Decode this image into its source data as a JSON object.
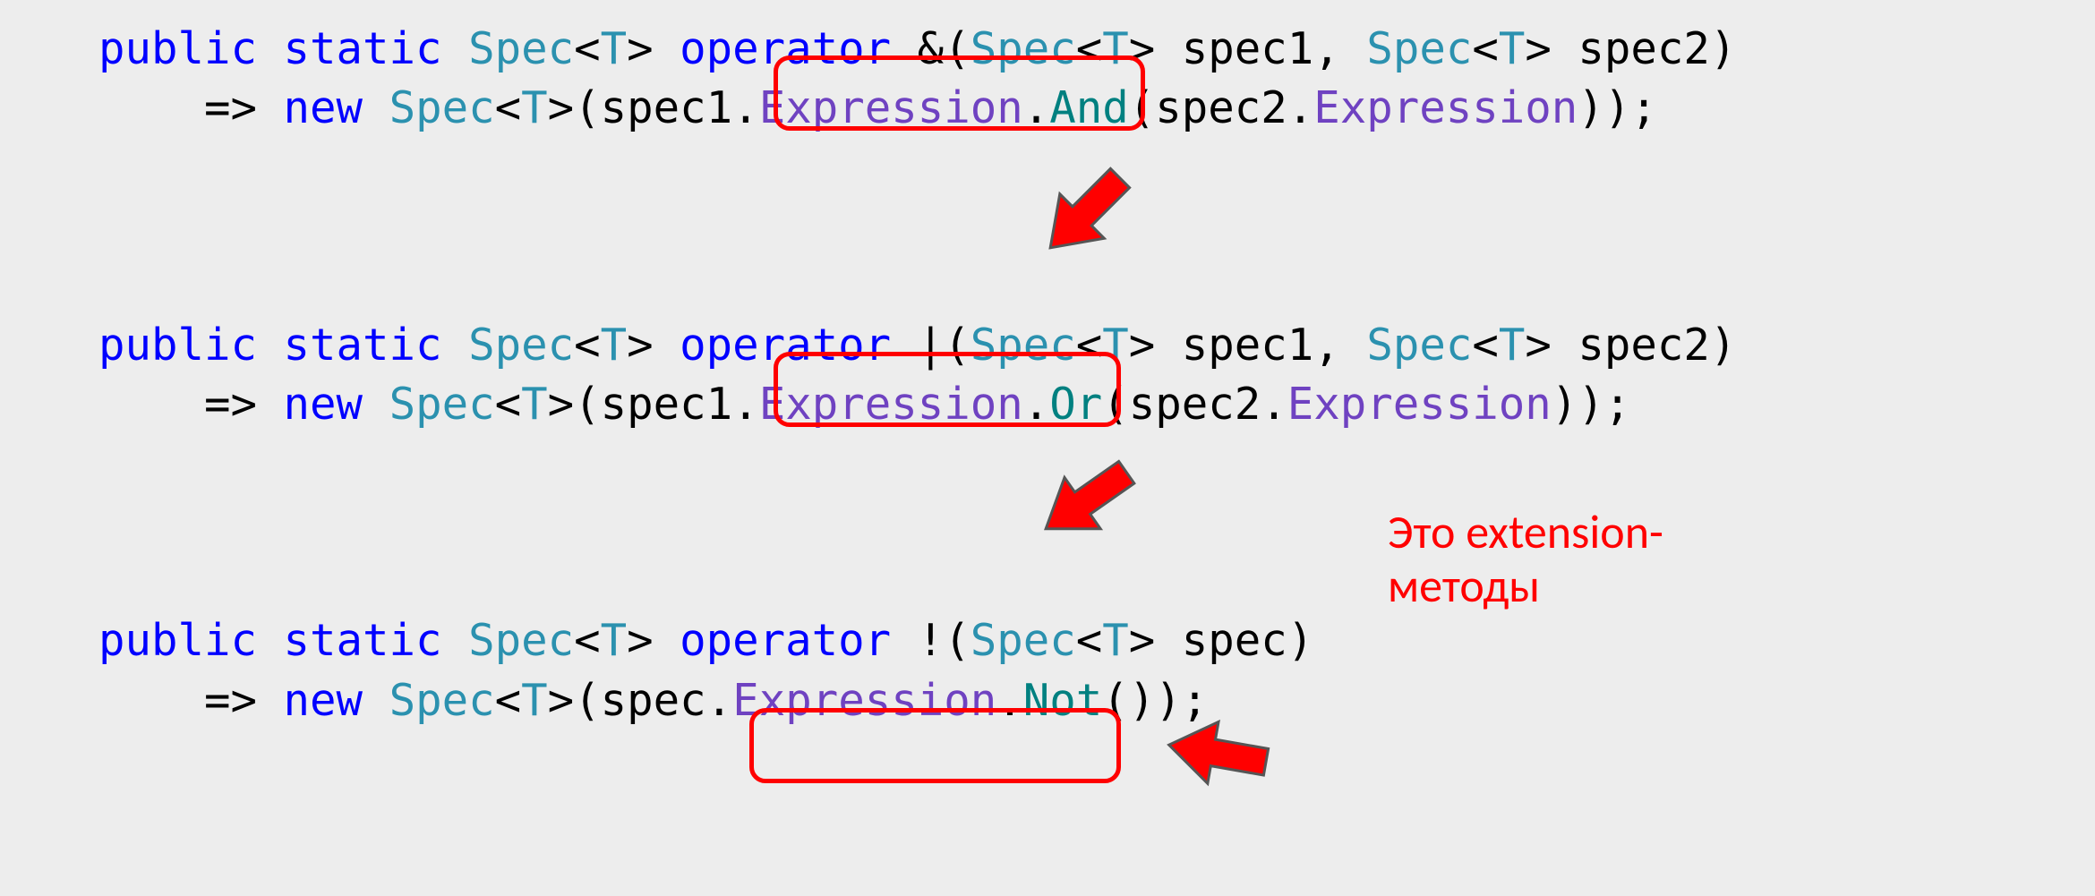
{
  "code": {
    "block1": {
      "sig": {
        "kw_public": "public",
        "kw_static": "static",
        "type1": "Spec",
        "lt1": "<",
        "gen1": "T",
        "gt1": ">",
        "kw_operator": "operator",
        "op": "&",
        "lp": "(",
        "ptype1": "Spec",
        "plt1": "<",
        "pgen1": "T",
        "pgt1": ">",
        "pname1": "spec1",
        "comma": ",",
        "ptype2": "Spec",
        "plt2": "<",
        "pgen2": "T",
        "pgt2": ">",
        "pname2": "spec2",
        "rp": ")"
      },
      "body": {
        "arrow": "=>",
        "kw_new": "new",
        "newtype": "Spec",
        "nlt": "<",
        "ngen": "T",
        "ngt": ">",
        "nlp": "(",
        "arg1": "spec1",
        "dot1": ".",
        "prop1": "Expression",
        "dot2": ".",
        "method": "And",
        "mlp": "(",
        "arg2": "spec2",
        "dot3": ".",
        "prop2": "Expression",
        "mrp": ")",
        "nrp": ")",
        "semi": ";"
      }
    },
    "block2": {
      "sig": {
        "kw_public": "public",
        "kw_static": "static",
        "type1": "Spec",
        "lt1": "<",
        "gen1": "T",
        "gt1": ">",
        "kw_operator": "operator",
        "op": "|",
        "lp": "(",
        "ptype1": "Spec",
        "plt1": "<",
        "pgen1": "T",
        "pgt1": ">",
        "pname1": "spec1",
        "comma": ",",
        "ptype2": "Spec",
        "plt2": "<",
        "pgen2": "T",
        "pgt2": ">",
        "pname2": "spec2",
        "rp": ")"
      },
      "body": {
        "arrow": "=>",
        "kw_new": "new",
        "newtype": "Spec",
        "nlt": "<",
        "ngen": "T",
        "ngt": ">",
        "nlp": "(",
        "arg1": "spec1",
        "dot1": ".",
        "prop1": "Expression",
        "dot2": ".",
        "method": "Or",
        "mlp": "(",
        "arg2": "spec2",
        "dot3": ".",
        "prop2": "Expression",
        "mrp": ")",
        "nrp": ")",
        "semi": ";"
      }
    },
    "block3": {
      "sig": {
        "kw_public": "public",
        "kw_static": "static",
        "type1": "Spec",
        "lt1": "<",
        "gen1": "T",
        "gt1": ">",
        "kw_operator": "operator",
        "op": "!",
        "lp": "(",
        "ptype1": "Spec",
        "plt1": "<",
        "pgen1": "T",
        "pgt1": ">",
        "pname1": "spec",
        "rp": ")"
      },
      "body": {
        "arrow": "=>",
        "kw_new": "new",
        "newtype": "Spec",
        "nlt": "<",
        "ngen": "T",
        "ngt": ">",
        "nlp": "(",
        "arg1": "spec",
        "dot1": ".",
        "prop1": "Expression",
        "dot2": ".",
        "method": "Not",
        "mlp": "(",
        "mrp": ")",
        "nrp": ")",
        "semi": ";"
      }
    }
  },
  "annotation": {
    "line1": "Это extension-",
    "line2": "методы"
  },
  "colors": {
    "highlight": "#ff0000",
    "keyword": "#0000ff",
    "type": "#2b91af",
    "property": "#6f42c1",
    "method": "#008080",
    "bg": "#ededed"
  }
}
